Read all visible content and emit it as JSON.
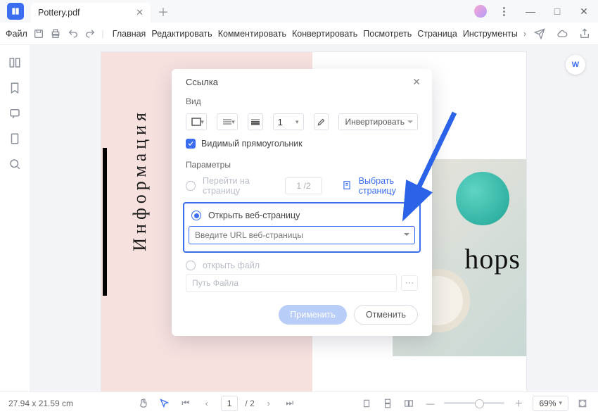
{
  "titlebar": {
    "tab_label": "Pottery.pdf"
  },
  "toolbar": {
    "file_menu": "Файл",
    "menu": [
      "Главная",
      "Редактировать",
      "Комментировать",
      "Конвертировать",
      "Посмотреть",
      "Страница",
      "Инструменты"
    ]
  },
  "document": {
    "vertical_title": "Информация",
    "partial_word": "hops"
  },
  "dialog": {
    "title": "Ссылка",
    "section_view": "Вид",
    "line_width": "1",
    "invert_label": "Инвертировать",
    "visible_rect": "Видимый прямоугольник",
    "section_params": "Параметры",
    "goto_page": "Перейти на страницу",
    "goto_page_value": "1 /2",
    "choose_page": "Выбрать страницу",
    "open_web": "Открыть веб-страницу",
    "url_placeholder": "Введите URL веб-страницы",
    "open_file": "открыть файл",
    "file_path_placeholder": "Путь Файла",
    "apply": "Применить",
    "cancel": "Отменить"
  },
  "statusbar": {
    "dimensions": "27.94 x 21.59 cm",
    "page_current": "1",
    "page_total": "/ 2",
    "zoom": "69%"
  }
}
